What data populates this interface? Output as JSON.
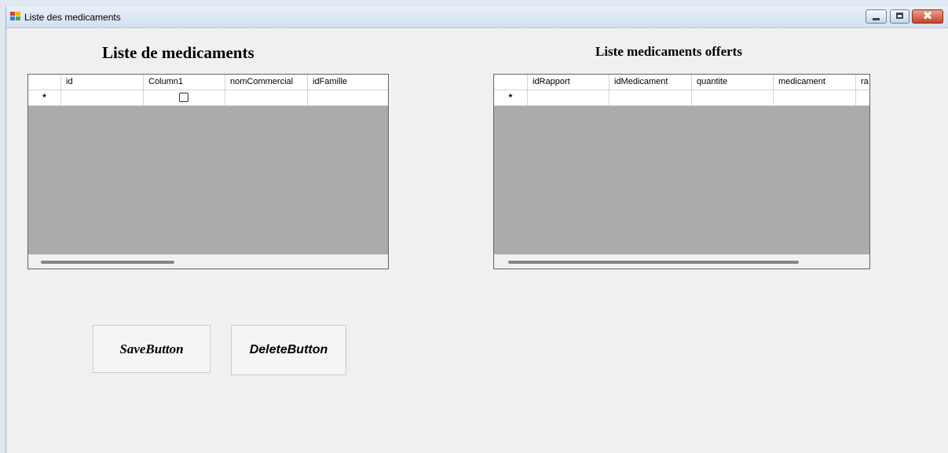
{
  "window": {
    "title": "Liste des medicaments",
    "controls": {
      "minimize": "minimize",
      "maximize": "maximize",
      "close": "✖"
    }
  },
  "left_panel": {
    "heading": "Liste de medicaments",
    "columns": [
      "id",
      "Column1",
      "nomCommercial",
      "idFamille"
    ],
    "new_row_marker": "*"
  },
  "right_panel": {
    "heading": "Liste medicaments offerts",
    "columns": [
      "idRapport",
      "idMedicament",
      "quantite",
      "medicament",
      "ra"
    ],
    "new_row_marker": "*"
  },
  "buttons": {
    "save": "SaveButton",
    "delete": "DeleteButton"
  },
  "icons": {
    "app": "form-app-icon",
    "minimize": "minimize-icon",
    "maximize": "maximize-icon",
    "close": "close-icon",
    "checkbox": "checkbox-icon"
  },
  "colors": {
    "form_background": "#f0f0f0",
    "grid_background": "#ababab",
    "close_button": "#c7432c"
  }
}
